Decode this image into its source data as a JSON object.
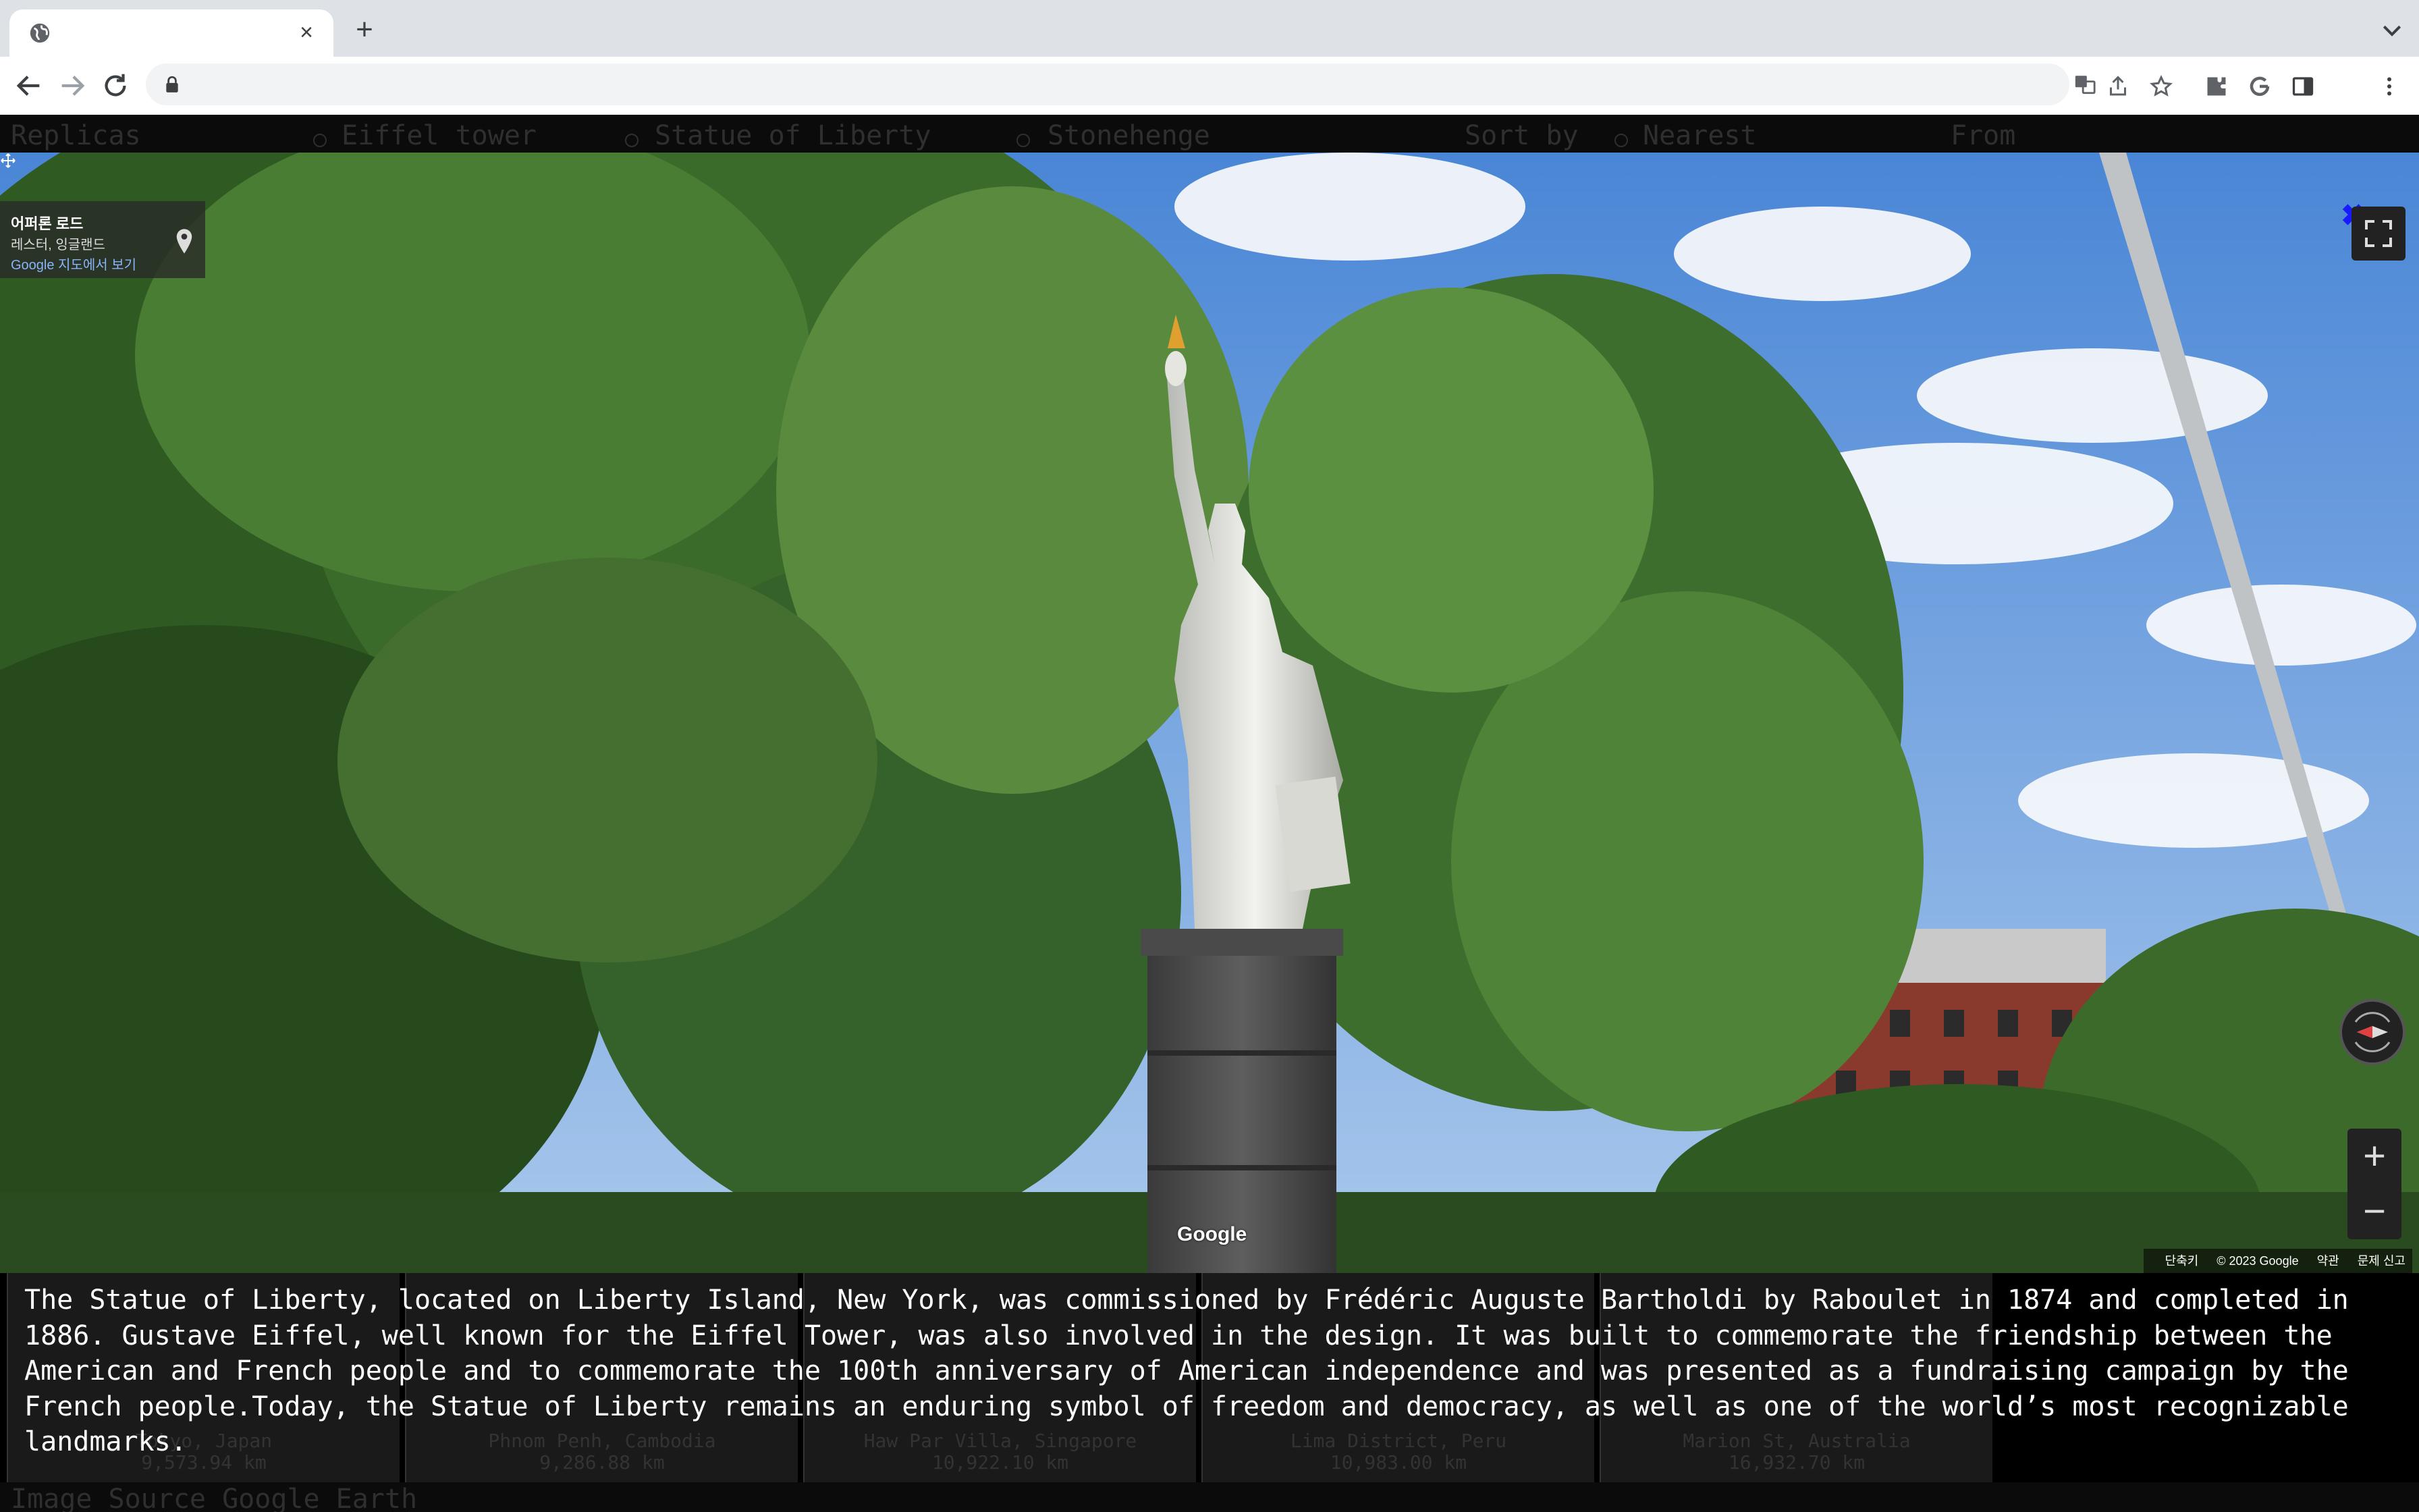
{
  "browser": {
    "tab_title": "",
    "url": "",
    "tab_close": "×",
    "new_tab": "+"
  },
  "filter_bar": {
    "replicas_label": "Replicas",
    "options": [
      "Eiffel tower",
      "Statue of Liberty",
      "Stonehenge"
    ],
    "selected_option": "Statue of Liberty",
    "sort_label": "Sort by",
    "sort_option": "Nearest",
    "from_label": "From"
  },
  "street_view": {
    "address_title": "어퍼론 로드",
    "address_region": "레스터, 잉글랜드",
    "map_link": "Google 지도에서 보기",
    "close_symbol": "✖",
    "google_logo": "Google",
    "attribution": {
      "shortcuts": "단축키",
      "copyright": "© 2023 Google",
      "terms": "약관",
      "report": "문제 신고"
    },
    "zoom_in": "+",
    "zoom_out": "−"
  },
  "description": "The Statue of Liberty, located on Liberty Island, New York, was commissioned by Frédéric Auguste Bartholdi by Raboulet in 1874 and completed in 1886. Gustave Eiffel, well known for the Eiffel Tower, was also involved in the design. It was built to commemorate the friendship between the American and French people and to commemorate the 100th anniversary of American independence and was presented as a fundraising campaign by the French people.Today, the Statue of Liberty remains an enduring symbol of freedom and democracy, as well as one of the world’s most recognizable landmarks.",
  "replica_thumbs": [
    {
      "name": "Tokyo, Japan",
      "distance": "9,573.94 km"
    },
    {
      "name": "Phnom Penh, Cambodia",
      "distance": "9,286.88 km"
    },
    {
      "name": "Haw Par Villa, Singapore",
      "distance": "10,922.10 km"
    },
    {
      "name": "Lima District, Peru",
      "distance": "10,983.00 km"
    },
    {
      "name": "Marion St, Australia",
      "distance": "16,932.70 km"
    }
  ],
  "footer": {
    "source_text": "Image Source Google Earth"
  },
  "colors": {
    "accent_close": "#1a1aff",
    "map_link": "#8ab4f8"
  }
}
